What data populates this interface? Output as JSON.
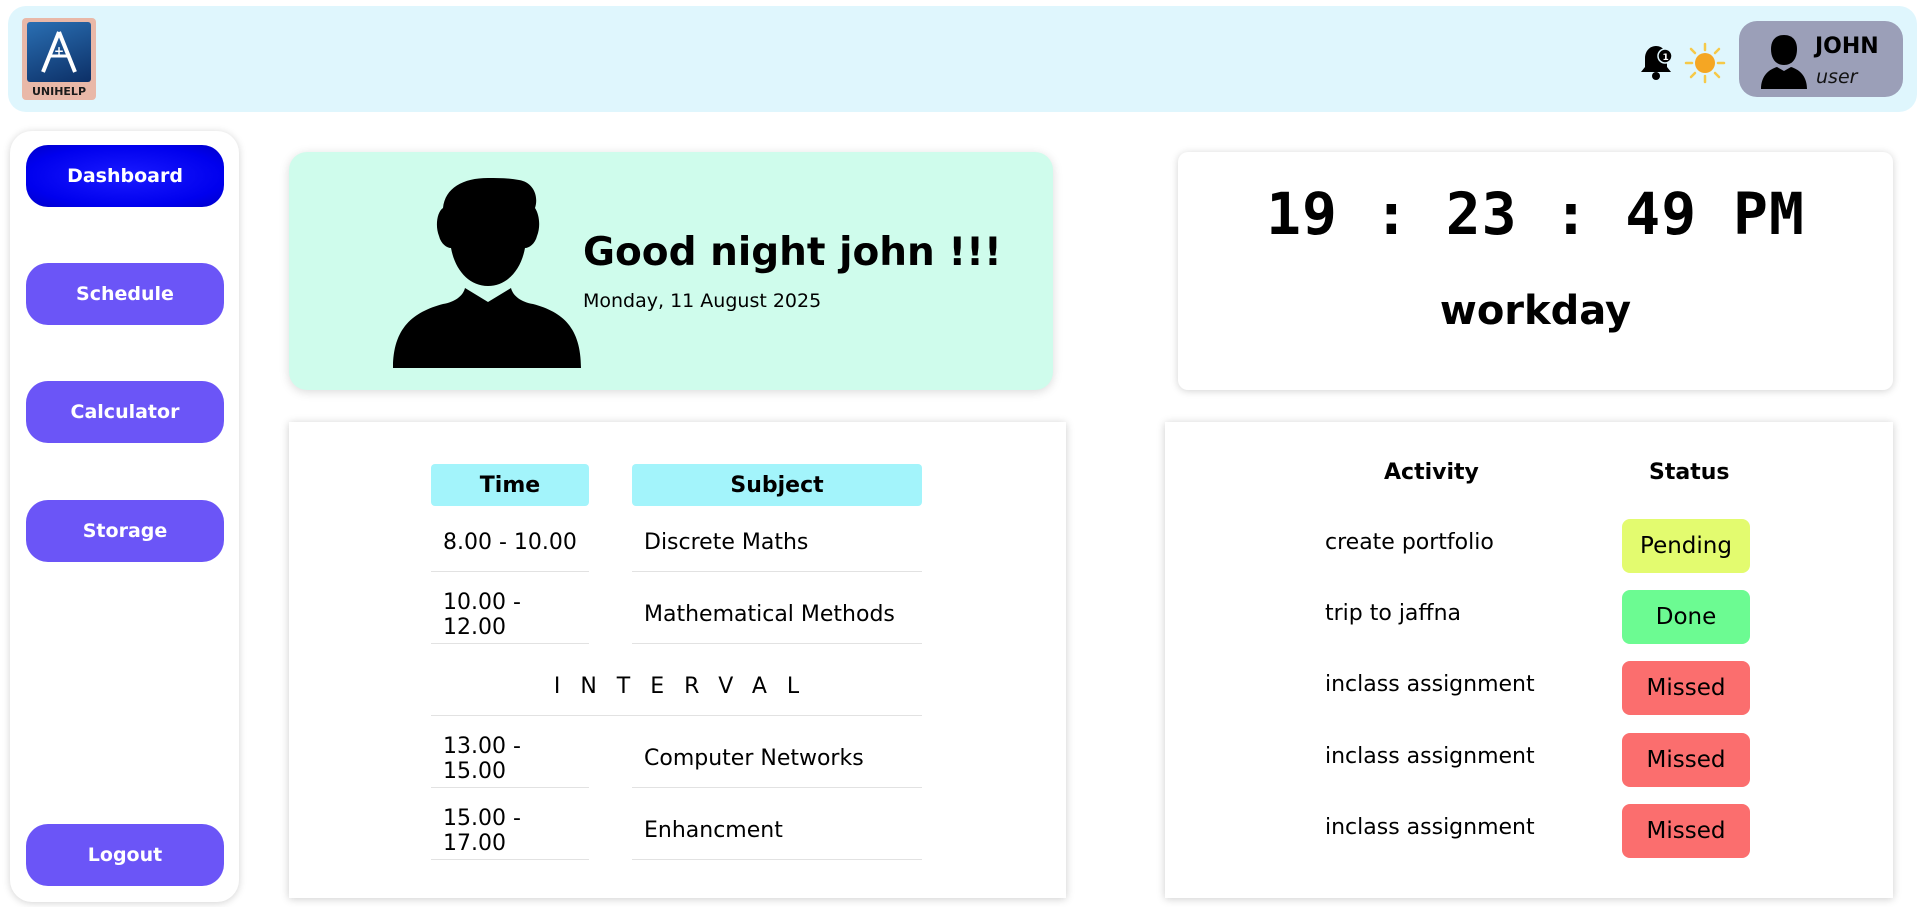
{
  "app": {
    "logo_text": "UNIHELP",
    "notification_count": "1"
  },
  "user": {
    "name": "JOHN",
    "role": "user"
  },
  "sidebar": {
    "items": [
      {
        "label": "Dashboard",
        "active": true
      },
      {
        "label": "Schedule",
        "active": false
      },
      {
        "label": "Calculator",
        "active": false
      },
      {
        "label": "Storage",
        "active": false
      }
    ],
    "logout_label": "Logout"
  },
  "greeting": {
    "message": "Good night john !!!",
    "date": "Monday, 11 August 2025"
  },
  "clock": {
    "time": "19 : 23 : 49 PM",
    "day_type": "workday"
  },
  "schedule": {
    "headers": {
      "time": "Time",
      "subject": "Subject"
    },
    "rows": [
      {
        "time": "8.00 - 10.00",
        "subject": "Discrete Maths"
      },
      {
        "time": "10.00 - 12.00",
        "subject": "Mathematical Methods"
      },
      {
        "interval": "INTERVAL"
      },
      {
        "time": "13.00 - 15.00",
        "subject": "Computer Networks"
      },
      {
        "time": "15.00 - 17.00",
        "subject": "Enhancment"
      }
    ]
  },
  "activities": {
    "headers": {
      "activity": "Activity",
      "status": "Status"
    },
    "rows": [
      {
        "activity": "create portfolio",
        "status": "Pending"
      },
      {
        "activity": "trip to jaffna",
        "status": "Done"
      },
      {
        "activity": "inclass assignment",
        "status": "Missed"
      },
      {
        "activity": "inclass assignment",
        "status": "Missed"
      },
      {
        "activity": "inclass assignment",
        "status": "Missed"
      }
    ],
    "status_colors": {
      "Pending": "#e3fb6f",
      "Done": "#6cfb92",
      "Missed": "#fb6e6e"
    }
  },
  "colors": {
    "header_bg": "#dff6fd",
    "nav_button": "#6b55f7",
    "nav_active": "#0000ee",
    "greeting_bg": "#cffcec",
    "table_header_bg": "#a3f4fb",
    "user_chip_bg": "#9b9fb8"
  }
}
